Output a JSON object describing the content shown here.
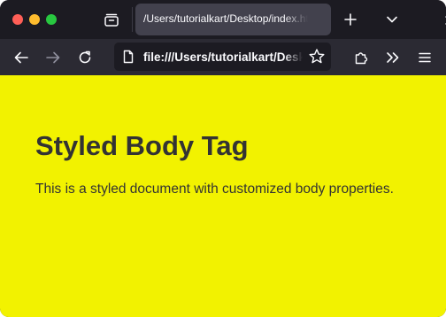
{
  "browser": {
    "tab": {
      "title": "/Users/tutorialkart/Desktop/index.html"
    },
    "address_bar": {
      "url": "file:///Users/tutorialkart/Desktop/index.html"
    },
    "icons": {
      "tabs_view": "tab-overview-icon",
      "tab_close": "close-icon",
      "new_tab": "plus-icon",
      "tab_list": "chevron-down-icon",
      "back": "arrow-left-icon",
      "forward": "arrow-right-icon",
      "reload": "reload-icon",
      "page": "document-icon",
      "bookmark": "star-icon",
      "extensions": "puzzle-icon",
      "overflow": "chevrons-right-icon",
      "menu": "hamburger-menu-icon"
    },
    "colors": {
      "toolbar": "#2b2a33",
      "tabstrip": "#1c1b22",
      "active_tab": "#42414d"
    }
  },
  "page": {
    "heading": "Styled Body Tag",
    "paragraph": "This is a styled document with customized body properties.",
    "background_color": "#f2f200",
    "text_color": "#333333"
  }
}
